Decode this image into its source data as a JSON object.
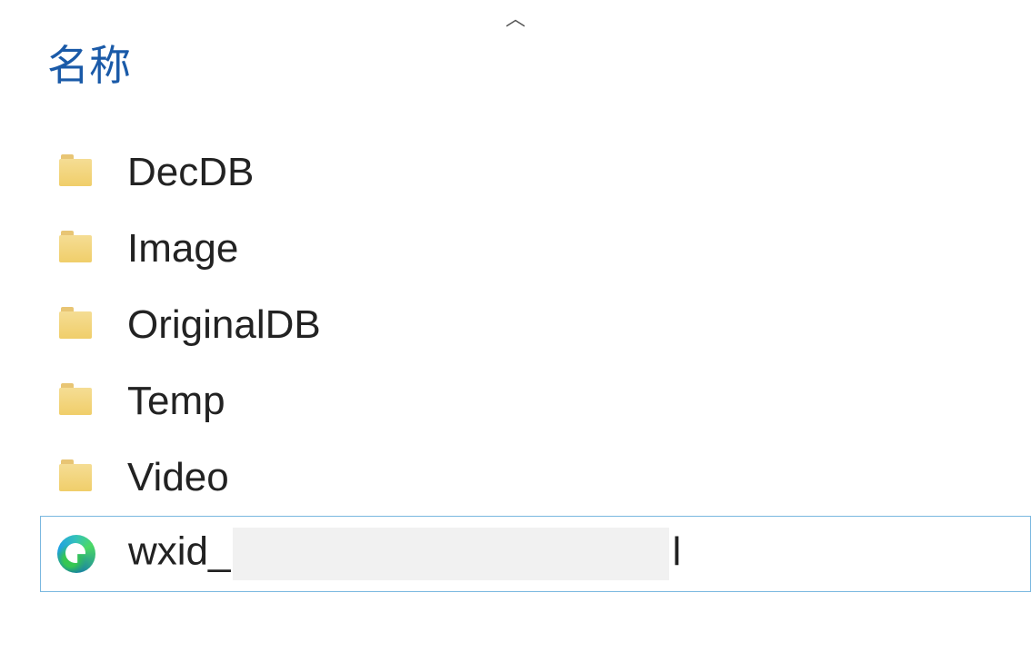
{
  "header": {
    "name_column": "名称"
  },
  "items": [
    {
      "type": "folder",
      "name": "DecDB"
    },
    {
      "type": "folder",
      "name": "Image"
    },
    {
      "type": "folder",
      "name": "OriginalDB"
    },
    {
      "type": "folder",
      "name": "Temp"
    },
    {
      "type": "folder",
      "name": "Video"
    },
    {
      "type": "html",
      "name_prefix": "wxid_",
      "name_suffix": "l",
      "redacted": true
    }
  ],
  "icons": {
    "chevron_up": "︿"
  }
}
